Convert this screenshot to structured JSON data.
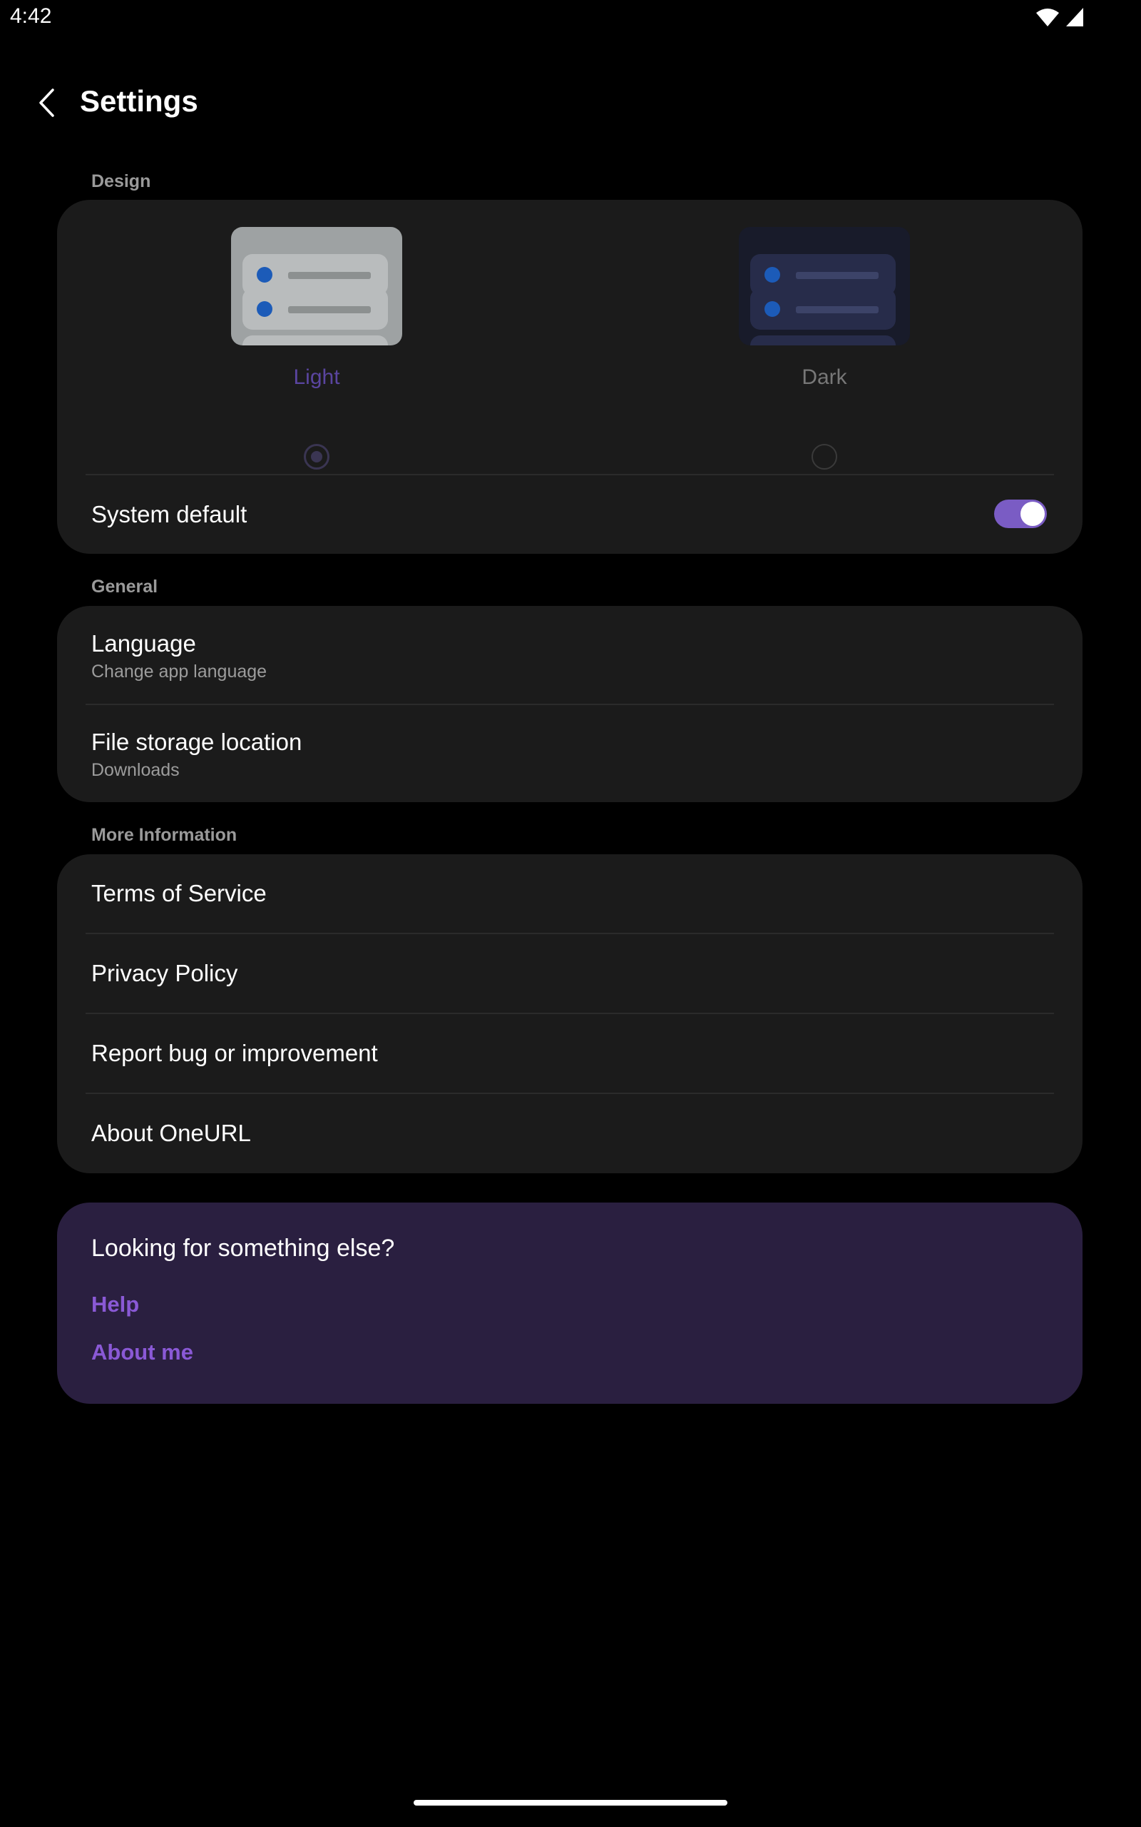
{
  "status_bar": {
    "time": "4:42"
  },
  "app_bar": {
    "title": "Settings"
  },
  "design": {
    "section_label": "Design",
    "light_label": "Light",
    "dark_label": "Dark",
    "selected_theme": "light",
    "system_default_label": "System default",
    "system_default_on": true
  },
  "general": {
    "section_label": "General",
    "language_title": "Language",
    "language_subtitle": "Change app language",
    "storage_title": "File storage location",
    "storage_subtitle": "Downloads"
  },
  "more_info": {
    "section_label": "More Information",
    "items": [
      {
        "label": "Terms of Service"
      },
      {
        "label": "Privacy Policy"
      },
      {
        "label": "Report bug or improvement"
      },
      {
        "label": "About OneURL"
      }
    ]
  },
  "promo": {
    "title": "Looking for something else?",
    "help_link": "Help",
    "about_link": "About me"
  },
  "colors": {
    "accent": "#7a5cc4",
    "link": "#8a59d6",
    "card_bg": "#1b1b1b",
    "promo_bg": "#2a1f40"
  },
  "icons": {
    "back": "chevron-left-icon",
    "wifi": "wifi-icon",
    "signal": "signal-icon"
  }
}
